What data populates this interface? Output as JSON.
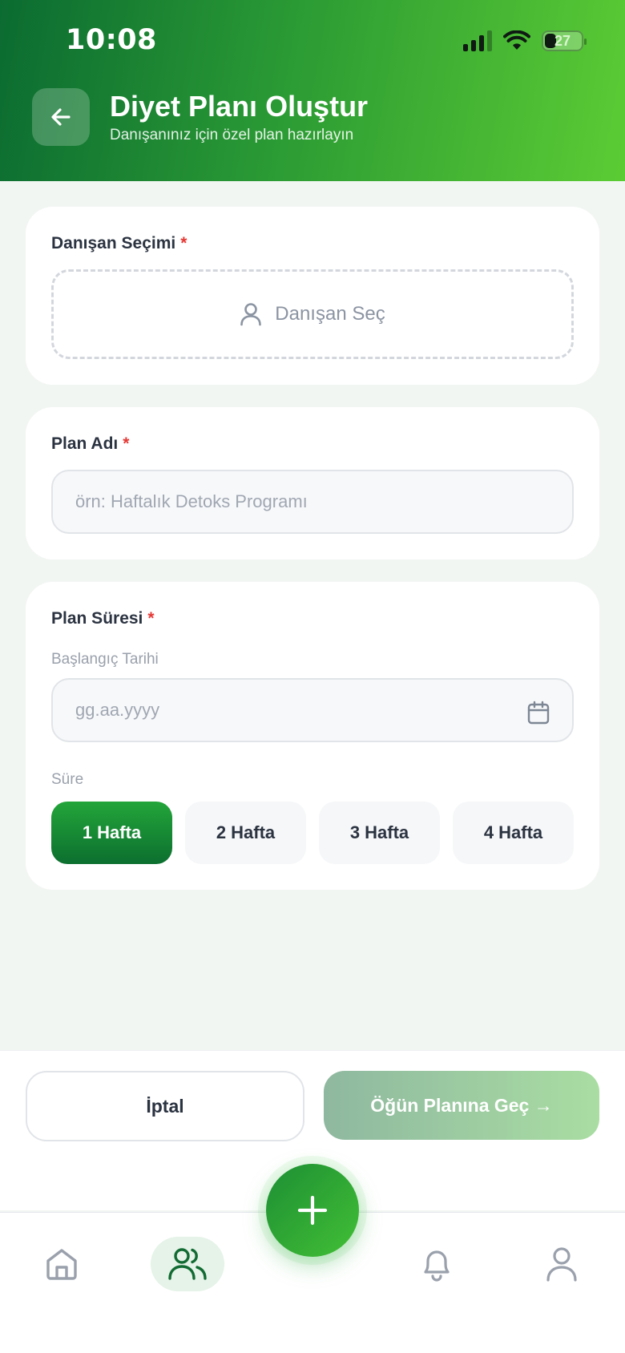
{
  "status_bar": {
    "time": "10:08",
    "battery": "27",
    "icons": [
      "signal-icon",
      "wifi-icon",
      "battery-icon"
    ]
  },
  "header": {
    "title": "Diyet Planı Oluştur",
    "subtitle": "Danışanınız için özel plan hazırlayın",
    "back_icon": "arrow-left-icon"
  },
  "client_section": {
    "label": "Danışan Seçimi",
    "required_mark": "*",
    "picker_text": "Danışan Seç",
    "icon": "user-icon"
  },
  "plan_name_section": {
    "label": "Plan Adı",
    "required_mark": "*",
    "value": "",
    "placeholder": "örn: Haftalık Detoks Programı"
  },
  "duration_section": {
    "label": "Plan Süresi",
    "required_mark": "*",
    "start_date_label": "Başlangıç Tarihi",
    "start_date_value": "",
    "start_date_placeholder": "gg.aa.yyyy",
    "calendar_icon": "calendar-icon",
    "length_label": "Süre",
    "options": [
      "1 Hafta",
      "2 Hafta",
      "3 Hafta",
      "4 Hafta"
    ],
    "selected": "1 Hafta"
  },
  "actions": {
    "cancel_label": "İptal",
    "next_label": "Öğün Planına Geç →"
  },
  "bottom_nav": {
    "items": [
      "home-icon",
      "users-icon",
      "plus-icon",
      "bell-icon",
      "profile-icon"
    ],
    "active": "users-icon"
  },
  "colors": {
    "brand_dark": "#0b6b31",
    "brand_light": "#5ccc34",
    "required": "#e53935"
  }
}
